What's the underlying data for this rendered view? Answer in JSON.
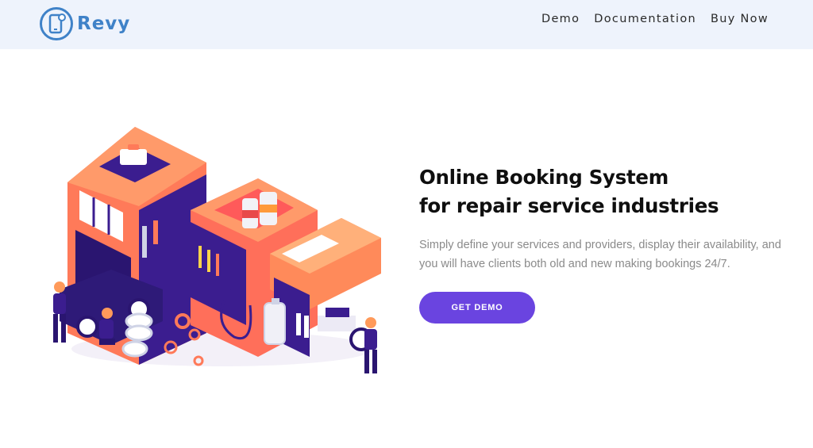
{
  "brand": {
    "name": "Revy",
    "accent": "#3f82c8"
  },
  "nav": {
    "items": [
      "Demo",
      "Documentation",
      "Buy Now"
    ]
  },
  "hero": {
    "headline_line1": "Online Booking System",
    "headline_line2": "for repair service industries",
    "description": "Simply define your services and providers, display their availability, and you will have clients both old and new making bookings 24/7.",
    "cta_label": "GET DEMO",
    "cta_color": "#6a44e0",
    "illustration": "isometric-repair-shop-illustration"
  },
  "colors": {
    "header_bg": "#eef3fc",
    "page_bg": "#ffffff"
  }
}
